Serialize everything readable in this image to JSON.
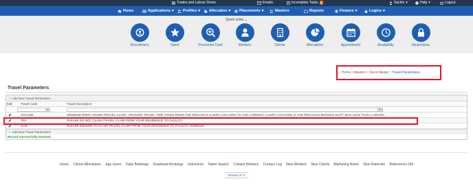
{
  "topbar": {
    "app_name": "Trades and Labour Demo",
    "emails": "Emails",
    "incomplete_tasks": "Incomplete Tasks",
    "incomplete_tasks_count": "3",
    "user": "Sachin",
    "help": "Help",
    "logout": "Logout"
  },
  "nav": {
    "home": "Home",
    "applications": "Applications",
    "profiles": "Profiles",
    "allocation": "Allocation",
    "placements": "Placements",
    "masters": "Masters",
    "reports": "Reports",
    "finance": "Finance",
    "logins": "Logins"
  },
  "quicklinks": {
    "label": "Quick Links",
    "items": [
      {
        "label": "Recruitment",
        "icon": "search-person-icon"
      },
      {
        "label": "Talent",
        "icon": "star-icon"
      },
      {
        "label": "Personnel Card",
        "icon": "zoom-in-icon"
      },
      {
        "label": "Workers",
        "icon": "person-icon"
      },
      {
        "label": "Clients",
        "icon": "building-icon"
      },
      {
        "label": "Allocations",
        "icon": "pie-chart-icon"
      },
      {
        "label": "Appointment",
        "icon": "calendar-icon"
      },
      {
        "label": "Availability",
        "icon": "clock-icon"
      },
      {
        "label": "Restrictions",
        "icon": "lock-icon"
      }
    ]
  },
  "breadcrumb": {
    "home": "Home",
    "masters": "Masters",
    "client_master": "Client Master",
    "current": "Travel Parameters",
    "sep": " \\ "
  },
  "page": {
    "title": "Travel Parameters"
  },
  "grid": {
    "add_label": "Add New Travel Parameters",
    "headers": {
      "edit": "Edit",
      "code": "Travel Code",
      "desc": "Travel Description"
    },
    "rows": [
      {
        "code": "SCHADE",
        "desc": "MINIMUM WORK HOURS TRAVEL CLAIM - PROVIDE TRAVEL TIME TAKEN FROM THE PREVIOUS CLIENT LOCATION TO THE CURRENT CLIENT LOCATION IF THE PREVIOUS BOOKED SHIFT WAS LESS THAN 2 HOURS."
      },
      {
        "code": "TRV",
        "desc": "PLEASE DO NOT CLAIM TRAVEL CLAIM FROM YOUR RESIDENCE TO FACILITY"
      },
      {
        "code": "CLM",
        "desc": "PLEASE ENSURE TO CLAIM TRAVEL CLAIM FROM YOUR RESIDENCE TO FACILITY ADDRESS"
      }
    ],
    "status": "Record successfully Inserted"
  },
  "footer": {
    "links": [
      "Users",
      "Clients Allocations",
      "App Users",
      "Daily Bookings",
      "Download Bookings",
      "Inductions",
      "Talent Search",
      "Contact Workers",
      "Contact Log",
      "New Workers",
      "New Clients",
      "Marketing Notes",
      "New Referrals",
      "References Old"
    ],
    "version": "Version 37.4"
  },
  "colors": {
    "nav_blue": "#1f5fb3",
    "top_dark": "#24374f",
    "highlight_red": "#e3142c",
    "success_green": "#1c9b29",
    "badge_orange": "#e8801b"
  }
}
